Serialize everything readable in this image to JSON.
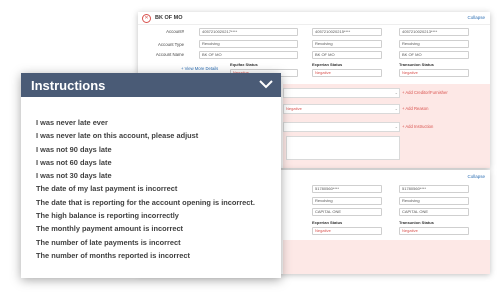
{
  "top_panel": {
    "bank_name": "BK OF MO",
    "collapse_label": "Collapse",
    "labels": {
      "account": "Account#",
      "account_type": "Account Type",
      "account_name": "Account Name"
    },
    "columns": [
      {
        "account": "4057210020217****",
        "type": "Revolving",
        "name": "BK OF MO"
      },
      {
        "account": "4057210020215****",
        "type": "Revolving",
        "name": "BK OF MO"
      },
      {
        "account": "4057210020213****",
        "type": "Revolving",
        "name": "BK OF MO"
      }
    ],
    "view_more": "+ View More Details",
    "status_headers": {
      "equifax": "Equifax Status",
      "experian": "Experian Status",
      "transunion": "Transunion Status"
    },
    "statuses": [
      "Negative",
      "Negative",
      "Negative"
    ],
    "red_links": {
      "furnisher": "+ Add Creditor/Furnisher",
      "reason": "+ Add Reason",
      "instruction": "+ Add Instruction"
    },
    "reason_value": "Negative"
  },
  "bottom_panel": {
    "collapse_label": "Collapse",
    "columns": [
      {
        "account": "51780560****",
        "type": "Revolving",
        "name": "CAPITAL ONE"
      },
      {
        "account": "51780560****",
        "type": "Revolving",
        "name": "CAPITAL ONE"
      }
    ],
    "status_headers": {
      "experian": "Experian Status",
      "transunion": "Transunion Status"
    },
    "statuses": [
      "Negative",
      "Negative"
    ]
  },
  "instructions": {
    "title": "Instructions",
    "items": [
      "I was never late ever",
      "I was never late on this account, please adjust",
      "I was not 90 days late",
      "I was not 60 days late",
      "I was not 30 days late",
      "The date of my last payment is incorrect",
      "The date that is reporting for the account opening is incorrect.",
      "The high balance is reporting incorrectly",
      "The monthly payment amount is incorrect",
      "The number of late payments is incorrect",
      "The number of months reported is incorrect"
    ]
  }
}
